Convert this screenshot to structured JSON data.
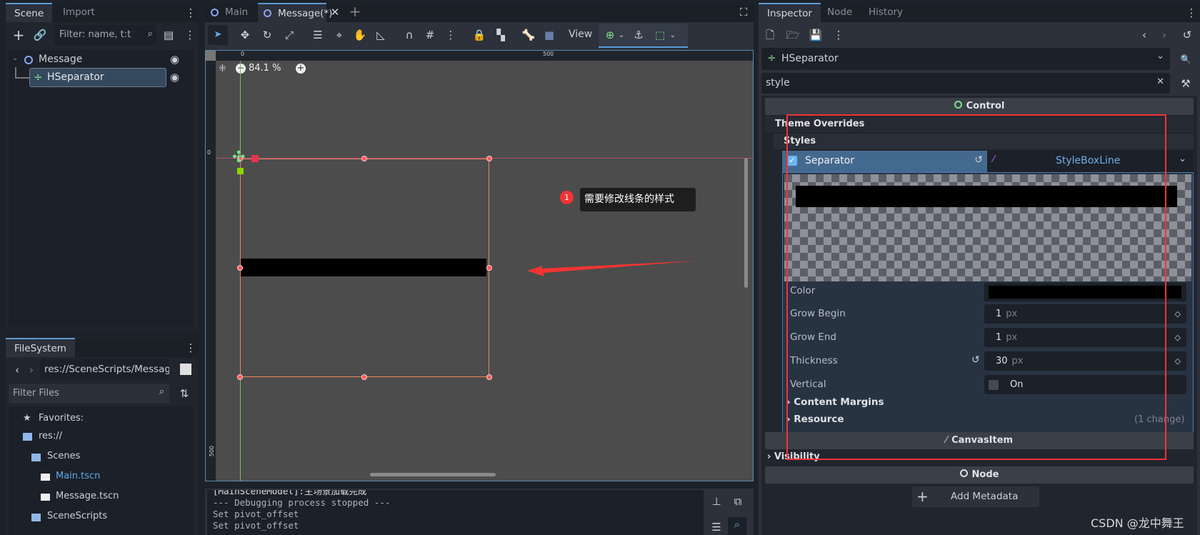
{
  "scene_dock": {
    "tabs": [
      "Scene",
      "Import"
    ],
    "filter_placeholder": "Filter: name, t:t",
    "tree": [
      {
        "label": "Message"
      },
      {
        "label": "HSeparator"
      }
    ]
  },
  "filesystem": {
    "tab": "FileSystem",
    "path": "res://SceneScripts/Message",
    "filter_placeholder": "Filter Files",
    "items": [
      "Favorites:",
      "res://",
      "Scenes",
      "Main.tscn",
      "Message.tscn",
      "SceneScripts"
    ]
  },
  "editor": {
    "tabs": [
      "Main",
      "Message(*)"
    ],
    "view_label": "View",
    "zoom": "84.1 %",
    "ruler": {
      "top": [
        "0",
        "500"
      ],
      "left": [
        "0",
        "500"
      ]
    },
    "annotation": {
      "badge": "1",
      "text": "需要修改线条的样式"
    }
  },
  "output": {
    "lines": [
      "[MainSceneModel]:主场景加载完成",
      "--- Debugging process stopped ---",
      "Set pivot_offset",
      "Set pivot_offset"
    ]
  },
  "inspector": {
    "tabs": [
      "Inspector",
      "Node",
      "History"
    ],
    "node": "HSeparator",
    "search": "style",
    "sections": {
      "control": "Control",
      "theme_overrides": "Theme Overrides",
      "styles": "Styles",
      "canvas_item": "CanvasItem",
      "visibility": "Visibility",
      "node": "Node"
    },
    "separator": {
      "label": "Separator",
      "checked": true,
      "resource": "StyleBoxLine"
    },
    "props": {
      "color": {
        "label": "Color",
        "value": "#000000"
      },
      "grow_begin": {
        "label": "Grow Begin",
        "value": "1",
        "unit": "px"
      },
      "grow_end": {
        "label": "Grow End",
        "value": "1",
        "unit": "px"
      },
      "thickness": {
        "label": "Thickness",
        "value": "30",
        "unit": "px"
      },
      "vertical": {
        "label": "Vertical",
        "value": "On",
        "checked": false
      }
    },
    "content_margins": "Content Margins",
    "resource": "Resource",
    "changes": "(1 change)",
    "add_metadata": "Add Metadata"
  },
  "watermark": "CSDN @龙中舞王",
  "colors": {
    "accent": "#5a9bd5",
    "annotation": "#ff3333",
    "selection": "#e8875a"
  }
}
